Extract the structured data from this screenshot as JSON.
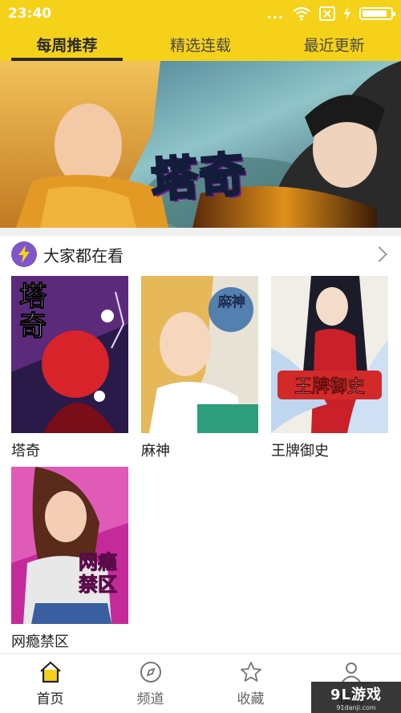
{
  "status_bar": {
    "time": "23:40",
    "dots": "..."
  },
  "tabs": [
    {
      "label": "每周推荐",
      "active": true
    },
    {
      "label": "精选连载",
      "active": false
    },
    {
      "label": "最近更新",
      "active": false
    }
  ],
  "banner": {
    "title": "塔奇"
  },
  "section": {
    "title": "大家都在看",
    "icon": "lightning-icon"
  },
  "comics": [
    {
      "title": "塔奇",
      "cover_text": "塔奇"
    },
    {
      "title": "麻神",
      "cover_text": "麻神"
    },
    {
      "title": "王牌御史",
      "cover_text": "王牌御史"
    },
    {
      "title": "网瘾禁区",
      "cover_text": "网瘾禁区"
    }
  ],
  "bottom_nav": [
    {
      "label": "首页",
      "icon": "home-icon",
      "active": true
    },
    {
      "label": "频道",
      "icon": "compass-icon",
      "active": false
    },
    {
      "label": "收藏",
      "icon": "star-icon",
      "active": false
    },
    {
      "label": "我的",
      "icon": "user-icon",
      "active": false
    }
  ],
  "watermark": {
    "main": "9L游戏",
    "sub": "91danji.com"
  },
  "colors": {
    "accent": "#f6d119",
    "bolt": "#7f56c9"
  }
}
